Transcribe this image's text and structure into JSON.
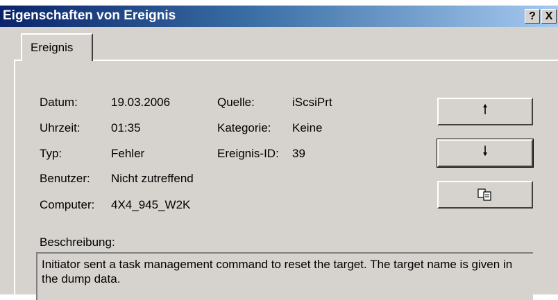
{
  "window": {
    "title": "Eigenschaften von Ereignis",
    "help_button": "?",
    "close_button": "X"
  },
  "tabs": [
    {
      "label": "Ereignis",
      "selected": true
    }
  ],
  "fields": {
    "date_label": "Datum:",
    "date_value": "19.03.2006",
    "time_label": "Uhrzeit:",
    "time_value": "01:35",
    "type_label": "Typ:",
    "type_value": "Fehler",
    "user_label": "Benutzer:",
    "user_value": "Nicht zutreffend",
    "computer_label": "Computer:",
    "computer_value": "4X4_945_W2K",
    "source_label": "Quelle:",
    "source_value": "iScsiPrt",
    "category_label": "Kategorie:",
    "category_value": "Keine",
    "event_id_label": "Ereignis-ID:",
    "event_id_value": "39"
  },
  "buttons": {
    "previous_icon": "arrow-up-icon",
    "next_icon": "arrow-down-icon",
    "copy_icon": "copy-icon"
  },
  "description": {
    "label": "Beschreibung:",
    "text": "Initiator sent a task management command to reset the target. The target name is given in the dump data."
  }
}
